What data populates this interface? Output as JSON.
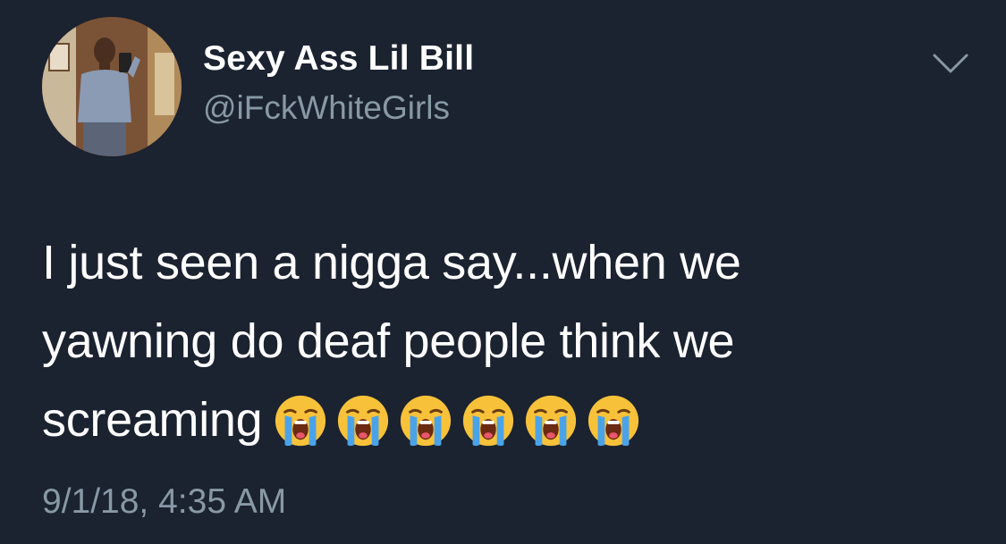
{
  "tweet": {
    "author": {
      "display_name": "Sexy Ass Lil Bill",
      "handle": "@iFckWhiteGirls",
      "avatar_icon": "profile-photo"
    },
    "menu_icon": "chevron-down-icon",
    "text_lines": [
      "I just seen a nigga say...when we",
      "yawning do deaf people think we",
      "screaming"
    ],
    "emoji": {
      "name": "loudly-crying-face",
      "count": 6
    },
    "timestamp": "9/1/18, 4:35 AM"
  },
  "colors": {
    "background": "#1b2230",
    "primary_text": "#ffffff",
    "secondary_text": "#8899a6"
  }
}
